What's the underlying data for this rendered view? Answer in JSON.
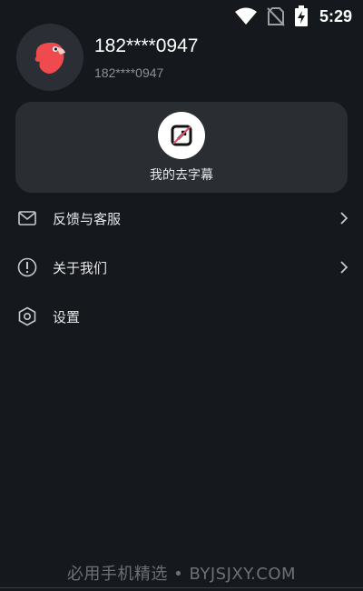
{
  "status_bar": {
    "time": "5:29",
    "icons": [
      "wifi-icon",
      "no-sim-icon",
      "battery-charging-icon"
    ]
  },
  "profile": {
    "avatar_icon": "red-parrot-avatar",
    "name": "182****0947",
    "account": "182****0947"
  },
  "card": {
    "icon": "remove-subtitle-icon",
    "label": "我的去字幕"
  },
  "menu": {
    "items": [
      {
        "icon": "mail-icon",
        "label": "反馈与客服",
        "has_arrow": true
      },
      {
        "icon": "info-circle-icon",
        "label": "关于我们",
        "has_arrow": true
      },
      {
        "icon": "hexagon-settings-icon",
        "label": "设置",
        "has_arrow": false
      }
    ]
  },
  "watermark": "必用手机精选 • BYJSJXY.COM",
  "colors": {
    "background": "#15181c",
    "card": "#2a2e33",
    "text": "#e6e7e9",
    "subtext": "#8b8f96",
    "avatar_red": "#ef4b4f"
  }
}
